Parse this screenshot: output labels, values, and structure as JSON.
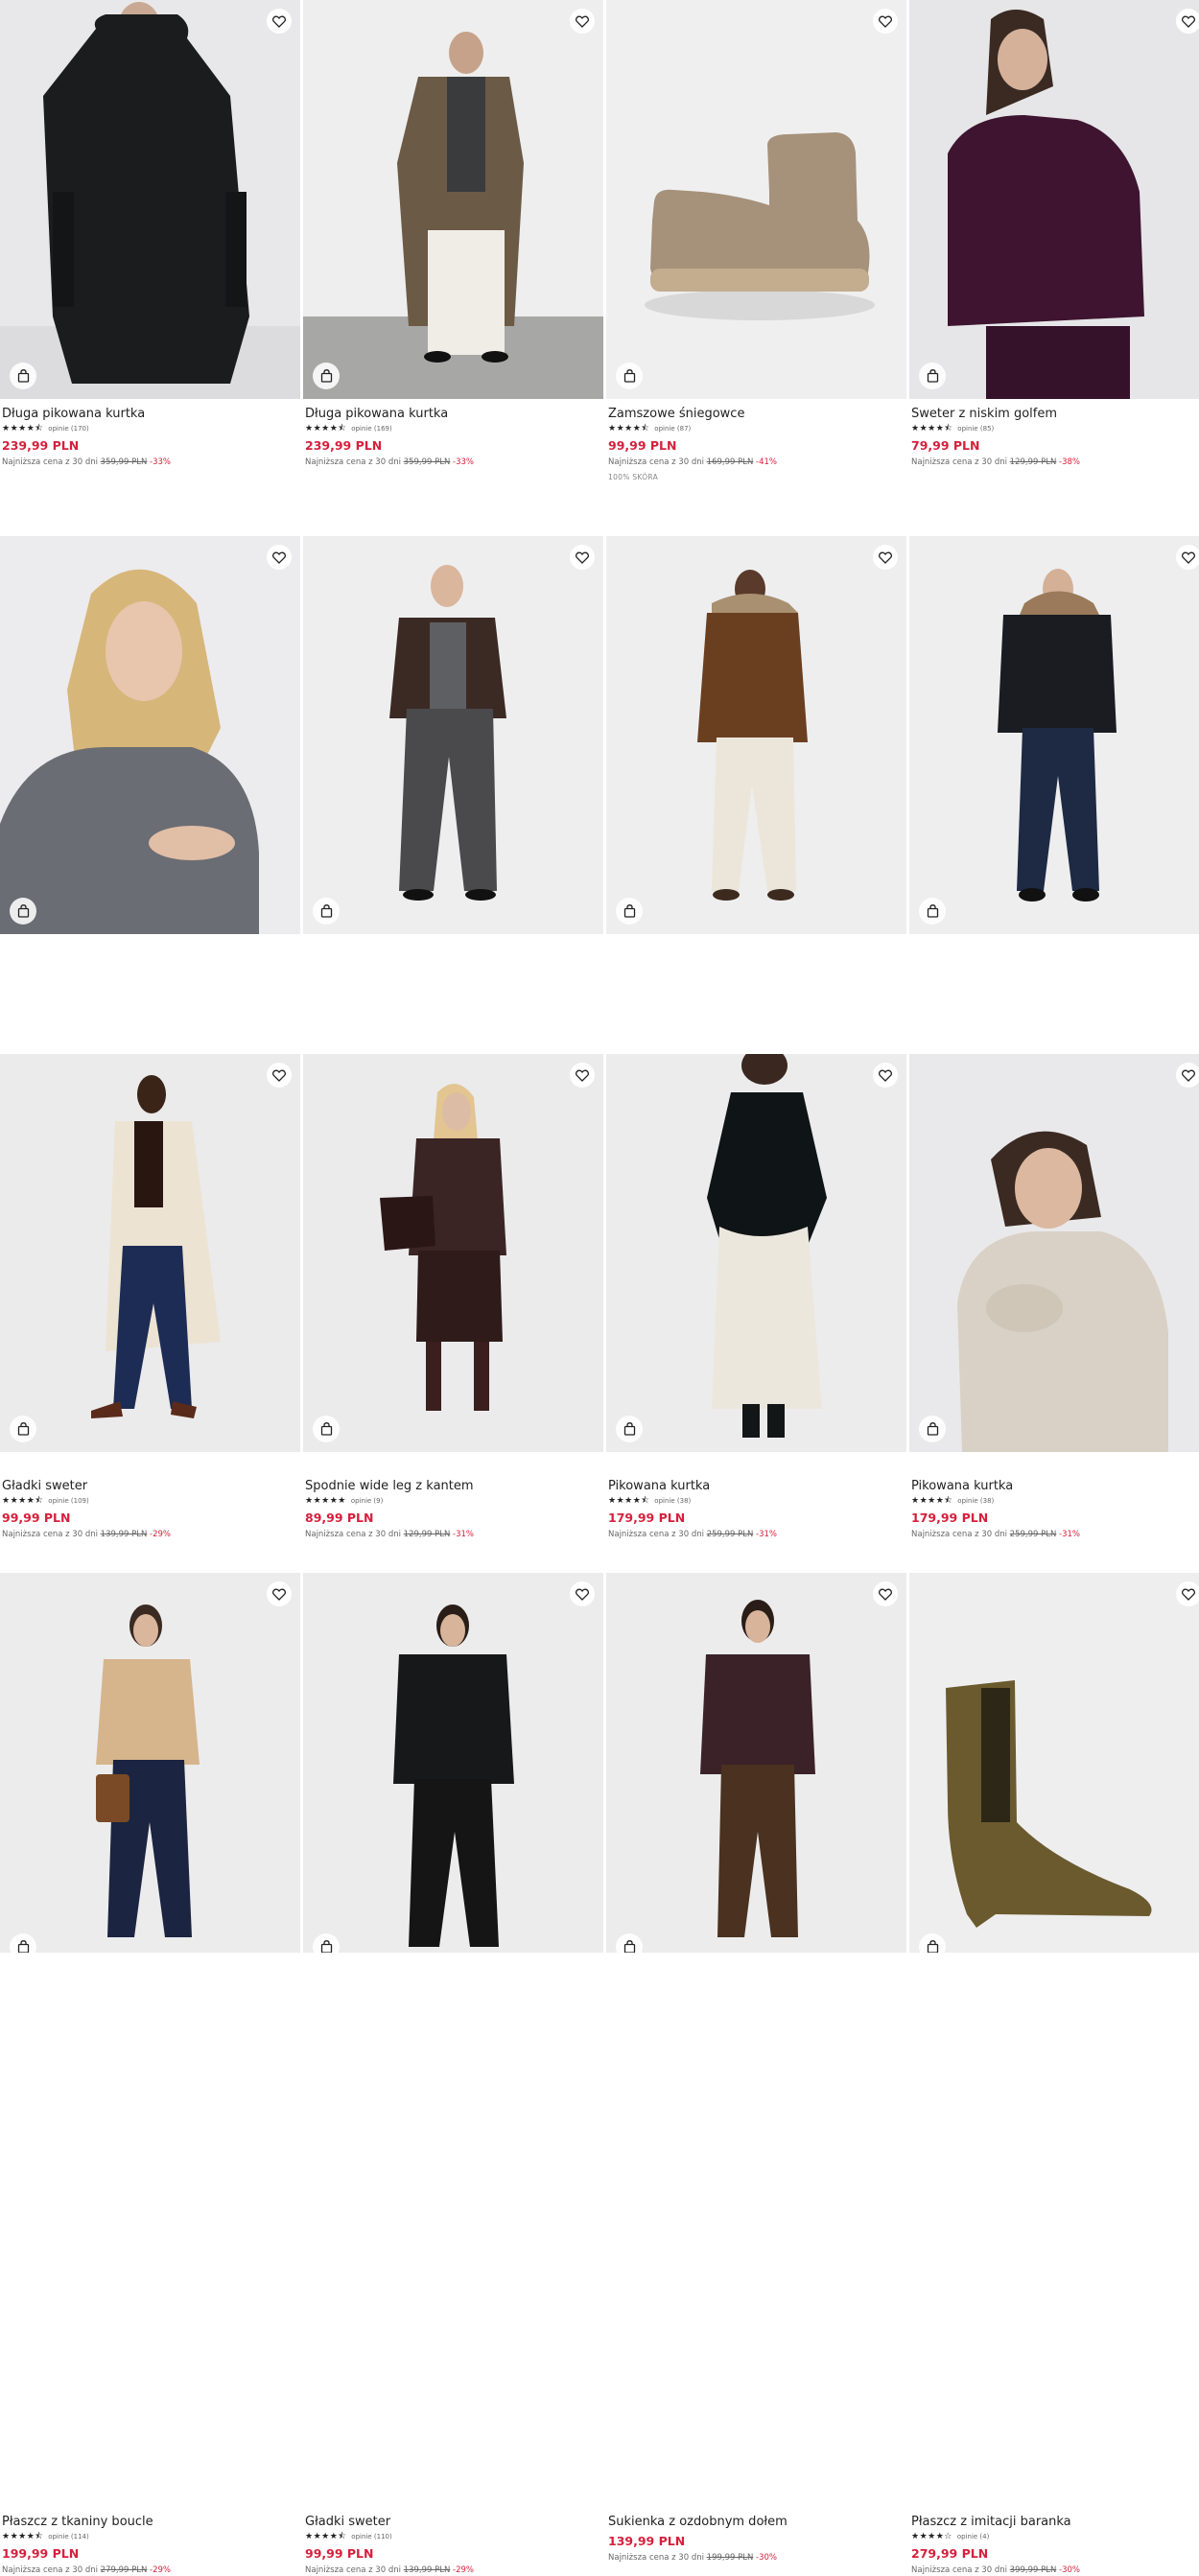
{
  "colors": {
    "price": "#d6203c",
    "text": "#222222",
    "muted": "#666666",
    "bg": "#ffffff"
  },
  "icons": {
    "favorite": "heart-icon",
    "cart": "shopping-bag-icon"
  },
  "products": [
    {
      "name": "Długa pikowana kurtka",
      "stars": "★★★★⯪",
      "reviews": "opinie (170)",
      "price": "239,99 PLN",
      "lowest_label": "Najniższa cena z 30 dni",
      "old_price": "359,99 PLN",
      "discount": "-33%",
      "extra": ""
    },
    {
      "name": "Długa pikowana kurtka",
      "stars": "★★★★⯪",
      "reviews": "opinie (169)",
      "price": "239,99 PLN",
      "lowest_label": "Najniższa cena z 30 dni",
      "old_price": "359,99 PLN",
      "discount": "-33%",
      "extra": ""
    },
    {
      "name": "Zamszowe śniegowce",
      "stars": "★★★★⯪",
      "reviews": "opinie (87)",
      "price": "99,99 PLN",
      "lowest_label": "Najniższa cena z 30 dni",
      "old_price": "169,99 PLN",
      "discount": "-41%",
      "extra": "100% SKÓRA"
    },
    {
      "name": "Sweter z niskim golfem",
      "stars": "★★★★⯪",
      "reviews": "opinie (85)",
      "price": "79,99 PLN",
      "lowest_label": "Najniższa cena z 30 dni",
      "old_price": "129,99 PLN",
      "discount": "-38%",
      "extra": ""
    },
    {
      "name": "Gładki sweter",
      "stars": "★★★★⯪",
      "reviews": "opinie (109)",
      "price": "99,99 PLN",
      "lowest_label": "Najniższa cena z 30 dni",
      "old_price": "139,99 PLN",
      "discount": "-29%",
      "extra": ""
    },
    {
      "name": "Spodnie wide leg z kantem",
      "stars": "★★★★★",
      "reviews": "opinie (9)",
      "price": "89,99 PLN",
      "lowest_label": "Najniższa cena z 30 dni",
      "old_price": "129,99 PLN",
      "discount": "-31%",
      "extra": ""
    },
    {
      "name": "Pikowana kurtka",
      "stars": "★★★★⯪",
      "reviews": "opinie (38)",
      "price": "179,99 PLN",
      "lowest_label": "Najniższa cena z 30 dni",
      "old_price": "259,99 PLN",
      "discount": "-31%",
      "extra": ""
    },
    {
      "name": "Pikowana kurtka",
      "stars": "★★★★⯪",
      "reviews": "opinie (38)",
      "price": "179,99 PLN",
      "lowest_label": "Najniższa cena z 30 dni",
      "old_price": "259,99 PLN",
      "discount": "-31%",
      "extra": ""
    },
    {
      "name": "Płaszcz z tkaniny boucle",
      "stars": "★★★★⯪",
      "reviews": "opinie (114)",
      "price": "199,99 PLN",
      "lowest_label": "Najniższa cena z 30 dni",
      "old_price": "279,99 PLN",
      "discount": "-29%",
      "extra": ""
    },
    {
      "name": "Gładki sweter",
      "stars": "★★★★⯪",
      "reviews": "opinie (110)",
      "price": "99,99 PLN",
      "lowest_label": "Najniższa cena z 30 dni",
      "old_price": "139,99 PLN",
      "discount": "-29%",
      "extra": ""
    },
    {
      "name": "Sukienka z ozdobnym dołem",
      "stars": "",
      "reviews": "",
      "price": "139,99 PLN",
      "lowest_label": "Najniższa cena z 30 dni",
      "old_price": "199,99 PLN",
      "discount": "-30%",
      "extra": ""
    },
    {
      "name": "Płaszcz z imitacji baranka",
      "stars": "★★★★☆",
      "reviews": "opinie (4)",
      "price": "279,99 PLN",
      "lowest_label": "Najniższa cena z 30 dni",
      "old_price": "399,99 PLN",
      "discount": "-30%",
      "extra": ""
    },
    {
      "name": "",
      "stars": "",
      "reviews": "",
      "price": "",
      "lowest_label": "",
      "old_price": "",
      "discount": "",
      "extra": ""
    },
    {
      "name": "",
      "stars": "",
      "reviews": "",
      "price": "",
      "lowest_label": "",
      "old_price": "",
      "discount": "",
      "extra": ""
    },
    {
      "name": "",
      "stars": "",
      "reviews": "",
      "price": "",
      "lowest_label": "",
      "old_price": "",
      "discount": "",
      "extra": ""
    },
    {
      "name": "",
      "stars": "",
      "reviews": "",
      "price": "",
      "lowest_label": "",
      "old_price": "",
      "discount": "",
      "extra": ""
    }
  ]
}
